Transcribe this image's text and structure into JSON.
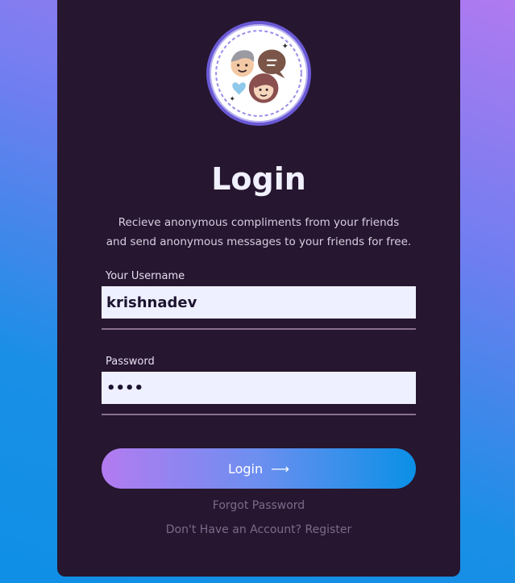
{
  "login": {
    "title": "Login",
    "subtitle_line1": "Recieve anonymous compliments from your friends",
    "subtitle_line2": "and send anonymous messages to your friends for free.",
    "username_label": "Your Username",
    "username_value": "krishnadev",
    "password_label": "Password",
    "password_value": "demo",
    "button_label": "Login",
    "button_icon": "arrow-right-icon",
    "forgot_link": "Forgot Password",
    "register_link": "Don't Have an Account? Register"
  },
  "colors": {
    "card_bg": "#26162f",
    "input_bg": "#eef0ff",
    "button_gradient_start": "#b37bf0",
    "button_gradient_end": "#0a90e6"
  }
}
